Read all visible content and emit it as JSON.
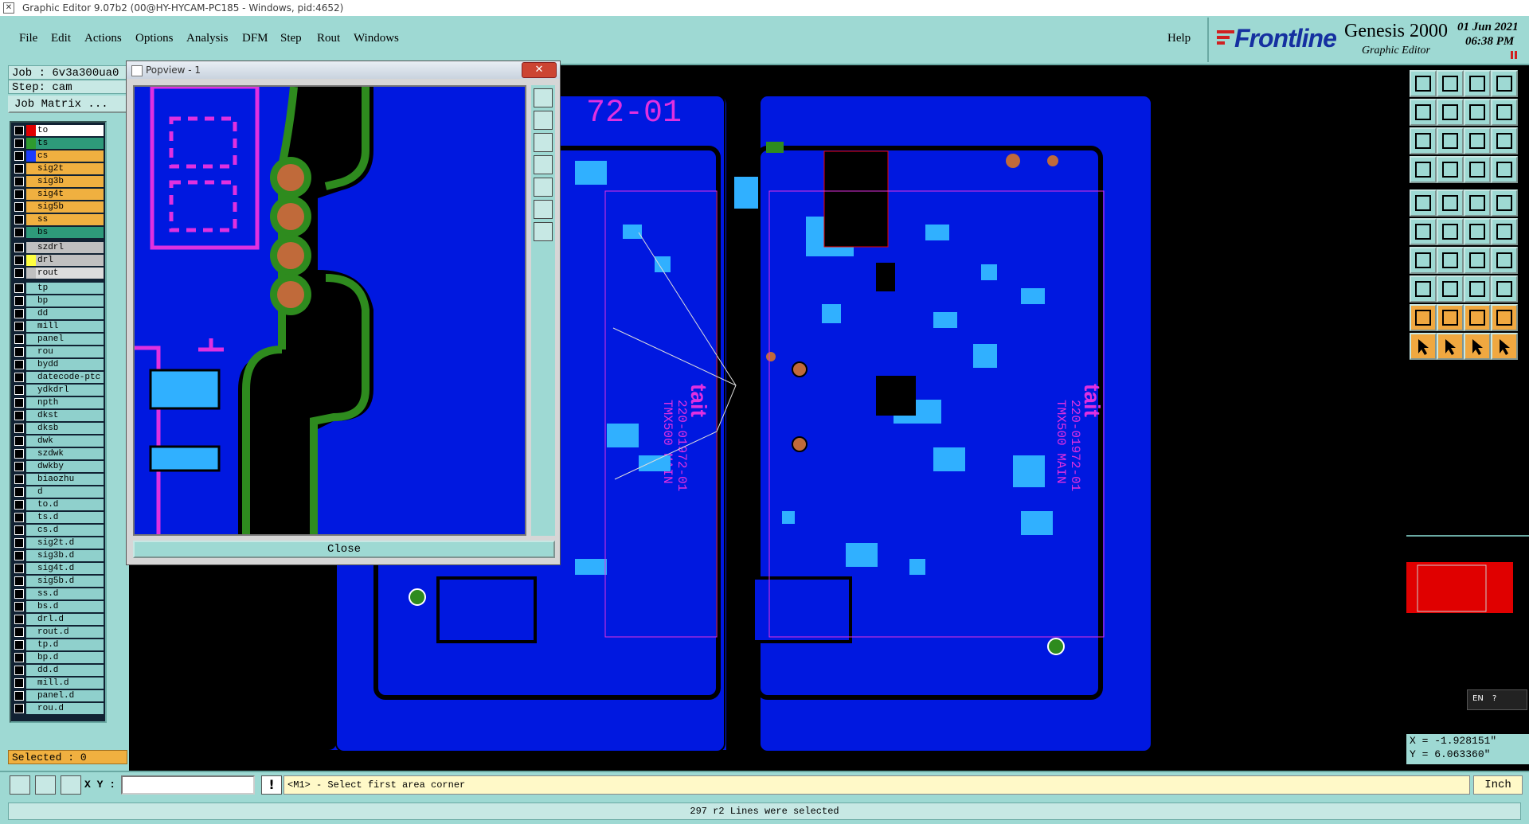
{
  "window": {
    "title": "Graphic Editor 9.07b2 (00@HY-HYCAM-PC185 - Windows, pid:4652)"
  },
  "menu": {
    "items": [
      "File",
      "Edit",
      "Actions",
      "Options",
      "Analysis",
      "DFM",
      "Step",
      "Rout",
      "Windows"
    ],
    "help": "Help"
  },
  "brand": {
    "logo": "Frontline",
    "product": "Genesis 2000",
    "subtitle": "Graphic Editor",
    "date": "01 Jun 2021",
    "time": "06:38 PM"
  },
  "job": {
    "job_line": "Job : 6v3a300ua0",
    "step_line": "Step: cam",
    "matrix_button": "Job Matrix ..."
  },
  "layers": {
    "groups": [
      [
        {
          "name": "to",
          "color": "#e00000",
          "fill": "#ffffff"
        },
        {
          "name": "ts",
          "color": "#2e9a2e",
          "fill": "#2e9a7a"
        },
        {
          "name": "cs",
          "color": "#1a3cff",
          "fill": "#f0b040"
        },
        {
          "name": "sig2t",
          "color": "#f0b040",
          "fill": "#f0b040"
        },
        {
          "name": "sig3b",
          "color": "#f0b040",
          "fill": "#f0b040"
        },
        {
          "name": "sig4t",
          "color": "#f0b040",
          "fill": "#f0b040"
        },
        {
          "name": "sig5b",
          "color": "#f0b040",
          "fill": "#f0b040"
        },
        {
          "name": "ss",
          "color": "#f0b040",
          "fill": "#f0b040"
        },
        {
          "name": "bs",
          "color": "#2e9a7a",
          "fill": "#2e9a7a"
        }
      ],
      [
        {
          "name": "szdrl",
          "color": "#c0c0c0",
          "fill": "#c0c0c0"
        },
        {
          "name": "drl",
          "color": "#ffff40",
          "fill": "#c0c0c0"
        },
        {
          "name": "rout",
          "color": "#c0c0c0",
          "fill": "#dcdcdc"
        }
      ],
      [
        {
          "name": "tp",
          "color": "#8fd0cc",
          "fill": "#8fd0cc"
        },
        {
          "name": "bp",
          "color": "#8fd0cc",
          "fill": "#8fd0cc"
        },
        {
          "name": "dd",
          "color": "#8fd0cc",
          "fill": "#8fd0cc"
        },
        {
          "name": "mill",
          "color": "#8fd0cc",
          "fill": "#8fd0cc"
        },
        {
          "name": "panel",
          "color": "#8fd0cc",
          "fill": "#8fd0cc"
        },
        {
          "name": "rou",
          "color": "#8fd0cc",
          "fill": "#8fd0cc"
        },
        {
          "name": "bydd",
          "color": "#8fd0cc",
          "fill": "#8fd0cc"
        },
        {
          "name": "datecode-ptc",
          "color": "#8fd0cc",
          "fill": "#8fd0cc"
        },
        {
          "name": "ydkdrl",
          "color": "#8fd0cc",
          "fill": "#8fd0cc"
        },
        {
          "name": "npth",
          "color": "#8fd0cc",
          "fill": "#8fd0cc"
        },
        {
          "name": "dkst",
          "color": "#8fd0cc",
          "fill": "#8fd0cc"
        },
        {
          "name": "dksb",
          "color": "#8fd0cc",
          "fill": "#8fd0cc"
        },
        {
          "name": "dwk",
          "color": "#8fd0cc",
          "fill": "#8fd0cc"
        },
        {
          "name": "szdwk",
          "color": "#8fd0cc",
          "fill": "#8fd0cc"
        },
        {
          "name": "dwkby",
          "color": "#8fd0cc",
          "fill": "#8fd0cc"
        },
        {
          "name": "biaozhu",
          "color": "#8fd0cc",
          "fill": "#8fd0cc"
        },
        {
          "name": "d",
          "color": "#8fd0cc",
          "fill": "#8fd0cc"
        },
        {
          "name": "to.d",
          "color": "#8fd0cc",
          "fill": "#8fd0cc"
        },
        {
          "name": "ts.d",
          "color": "#8fd0cc",
          "fill": "#8fd0cc"
        },
        {
          "name": "cs.d",
          "color": "#8fd0cc",
          "fill": "#8fd0cc"
        },
        {
          "name": "sig2t.d",
          "color": "#8fd0cc",
          "fill": "#8fd0cc"
        },
        {
          "name": "sig3b.d",
          "color": "#8fd0cc",
          "fill": "#8fd0cc"
        },
        {
          "name": "sig4t.d",
          "color": "#8fd0cc",
          "fill": "#8fd0cc"
        },
        {
          "name": "sig5b.d",
          "color": "#8fd0cc",
          "fill": "#8fd0cc"
        },
        {
          "name": "ss.d",
          "color": "#8fd0cc",
          "fill": "#8fd0cc"
        },
        {
          "name": "bs.d",
          "color": "#8fd0cc",
          "fill": "#8fd0cc"
        },
        {
          "name": "drl.d",
          "color": "#8fd0cc",
          "fill": "#8fd0cc"
        },
        {
          "name": "rout.d",
          "color": "#8fd0cc",
          "fill": "#8fd0cc"
        },
        {
          "name": "tp.d",
          "color": "#8fd0cc",
          "fill": "#8fd0cc"
        },
        {
          "name": "bp.d",
          "color": "#8fd0cc",
          "fill": "#8fd0cc"
        },
        {
          "name": "dd.d",
          "color": "#8fd0cc",
          "fill": "#8fd0cc"
        },
        {
          "name": "mill.d",
          "color": "#8fd0cc",
          "fill": "#8fd0cc"
        },
        {
          "name": "panel.d",
          "color": "#8fd0cc",
          "fill": "#8fd0cc"
        },
        {
          "name": "rou.d",
          "color": "#8fd0cc",
          "fill": "#8fd0cc"
        }
      ]
    ]
  },
  "selected": "Selected : 0",
  "popview": {
    "title": "Popview - 1",
    "close_label": "Close"
  },
  "board": {
    "text_top": "72-01",
    "text_silk_left": "tait",
    "text_silk_right": "tait",
    "text_pn_left": "220-01972-01",
    "text_pn_right": "220-01972-01",
    "text_main_left": "TMX500 MAIN",
    "text_main_right": "TMX500 MAIN"
  },
  "coords": {
    "x": "X = -1.928151\"",
    "y": "Y = 6.063360\""
  },
  "ime": "EN",
  "bottom": {
    "xy_label": "X Y :",
    "xy_value": "",
    "prompt": "<M1> - Select first area corner",
    "unit": "Inch",
    "status": "297 r2 Lines were selected"
  },
  "colors": {
    "ui_bg": "#9ed9d3",
    "board_blue": "#0018e0",
    "copper_green": "#2e8b1e",
    "pad_brown": "#c06a3a",
    "silk_magenta": "#e030e0",
    "cyan_pad": "#30b0ff"
  }
}
